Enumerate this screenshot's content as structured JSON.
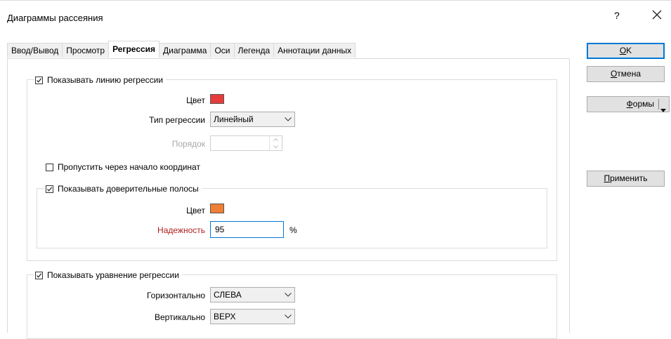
{
  "window": {
    "title": "Диаграммы рассеяния",
    "help_label": "?",
    "close_label": "✕"
  },
  "tabs": [
    {
      "label": "Ввод/Вывод",
      "active": false
    },
    {
      "label": "Просмотр",
      "active": false
    },
    {
      "label": "Регрессия",
      "active": true
    },
    {
      "label": "Диаграмма",
      "active": false
    },
    {
      "label": "Оси",
      "active": false
    },
    {
      "label": "Легенда",
      "active": false
    },
    {
      "label": "Аннотации данных",
      "active": false
    }
  ],
  "regression_line": {
    "label": "Показывать линию регрессии",
    "checked": true,
    "color_label": "Цвет",
    "color": "#e83c3c",
    "type_label": "Тип регрессии",
    "type_value": "Линейный",
    "order_label": "Порядок",
    "order_value": ""
  },
  "through_origin": {
    "label": "Пропустить через начало координат",
    "checked": false
  },
  "confidence_bands": {
    "label": "Показывать доверительные полосы",
    "checked": true,
    "color_label": "Цвет",
    "color": "#ef7f35",
    "reliability_label": "Надежность",
    "reliability_value": "95",
    "unit": "%"
  },
  "regression_equation": {
    "label": "Показывать уравнение регрессии",
    "checked": true,
    "horizontal_label": "Горизонтально",
    "horizontal_value": "СЛЕВА",
    "vertical_label": "Вертикально",
    "vertical_value": "ВЕРХ"
  },
  "buttons": {
    "ok": {
      "accel": "O",
      "rest": "K"
    },
    "cancel": {
      "accel": "О",
      "rest": "тмена"
    },
    "forms": {
      "accel": "Ф",
      "rest": "ормы"
    },
    "apply": {
      "accel": "П",
      "rest": "рименить"
    }
  },
  "colors": {
    "accent": "#0078d7",
    "button_face": "#e1e1e1",
    "label_required": "#b11e1e"
  }
}
